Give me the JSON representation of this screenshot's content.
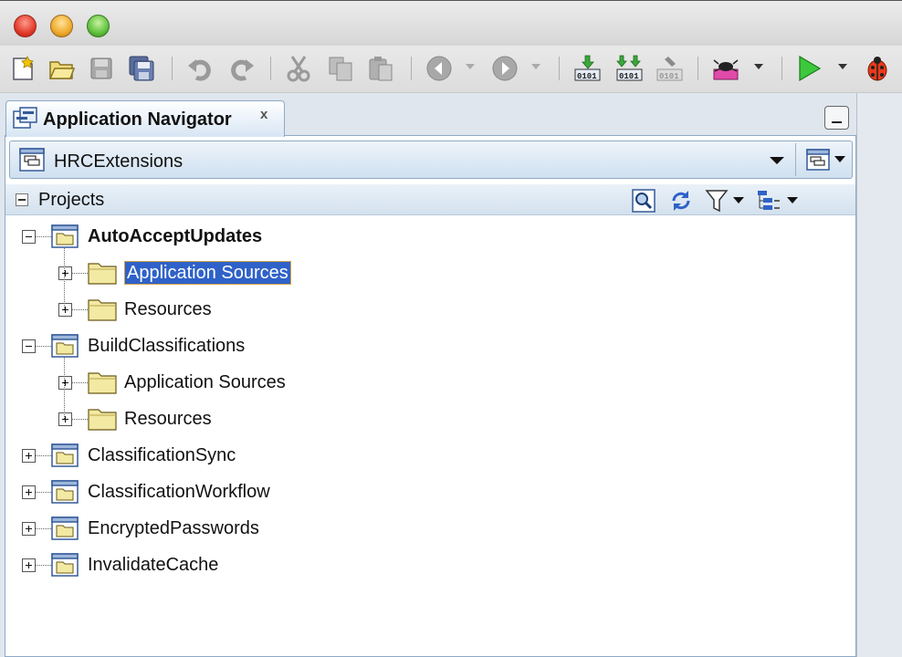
{
  "toolbar": {
    "items": [
      {
        "name": "new-icon",
        "icon": "new-file-star"
      },
      {
        "name": "open-icon",
        "icon": "folder-open"
      },
      {
        "name": "save-icon",
        "icon": "floppy"
      },
      {
        "name": "save-all-icon",
        "icon": "floppy-stack"
      },
      {
        "name": "undo-icon",
        "icon": "undo-arrow"
      },
      {
        "name": "redo-icon",
        "icon": "redo-arrow"
      },
      {
        "name": "cut-icon",
        "icon": "scissors"
      },
      {
        "name": "copy-icon",
        "icon": "copy-pages"
      },
      {
        "name": "paste-icon",
        "icon": "clipboard"
      },
      {
        "name": "back-icon",
        "icon": "circle-left"
      },
      {
        "name": "forward-icon",
        "icon": "circle-right"
      },
      {
        "name": "make-icon",
        "icon": "binary-down"
      },
      {
        "name": "rebuild-icon",
        "icon": "binary-double-down"
      },
      {
        "name": "clean-icon",
        "icon": "binary-broom"
      },
      {
        "name": "profile-icon",
        "icon": "ant"
      },
      {
        "name": "run-icon",
        "icon": "play-triangle"
      },
      {
        "name": "debug-icon",
        "icon": "ladybug"
      }
    ]
  },
  "tab": {
    "label": "Application Navigator",
    "close": "x"
  },
  "app_selector": {
    "value": "HRCExtensions"
  },
  "projects_bar": {
    "label": "Projects"
  },
  "tree": {
    "projects": [
      {
        "label": "AutoAcceptUpdates",
        "bold": true,
        "expanded": true,
        "children": [
          {
            "label": "Application Sources",
            "selected": true
          },
          {
            "label": "Resources",
            "selected": false
          }
        ]
      },
      {
        "label": "BuildClassifications",
        "bold": false,
        "expanded": true,
        "children": [
          {
            "label": "Application Sources",
            "selected": false
          },
          {
            "label": "Resources",
            "selected": false
          }
        ]
      },
      {
        "label": "ClassificationSync",
        "bold": false,
        "expanded": false,
        "children": []
      },
      {
        "label": "ClassificationWorkflow",
        "bold": false,
        "expanded": false,
        "children": []
      },
      {
        "label": "EncryptedPasswords",
        "bold": false,
        "expanded": false,
        "children": []
      },
      {
        "label": "InvalidateCache",
        "bold": false,
        "expanded": false,
        "children": []
      }
    ]
  },
  "colors": {
    "selection": "#2f62c8",
    "panel_border": "#8fa9c4",
    "folder_yellow": "#f2e9a3"
  }
}
